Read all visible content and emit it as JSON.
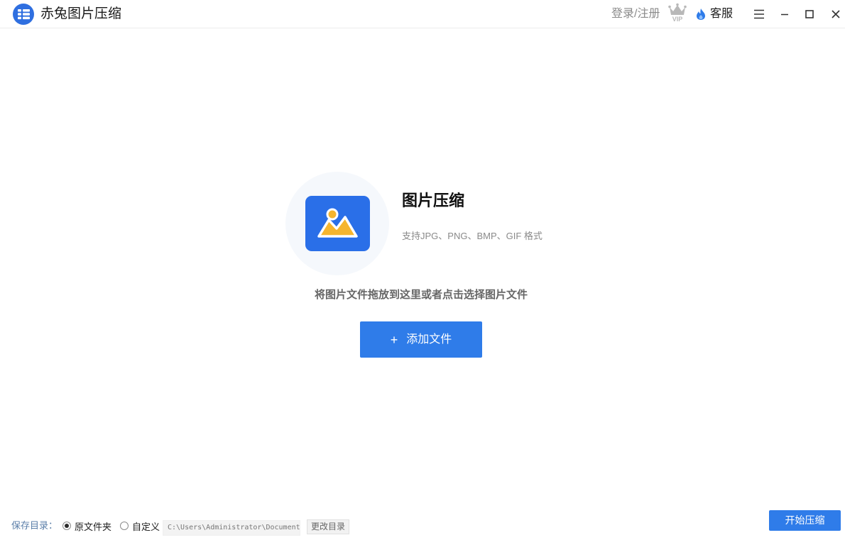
{
  "header": {
    "app_title": "赤兔图片压缩",
    "login_label": "登录/注册",
    "vip_label": "VIP",
    "service_label": "客服"
  },
  "main": {
    "title": "图片压缩",
    "subtitle": "支持JPG、PNG、BMP、GIF 格式",
    "drop_hint": "将图片文件拖放到这里或者点击选择图片文件",
    "add_button_plus": "+",
    "add_button_label": "添加文件"
  },
  "footer": {
    "save_dir_label": "保存目录：",
    "option_original": "原文件夹",
    "option_custom": "自定义",
    "custom_path": "C:\\Users\\Administrator\\Documents",
    "change_dir_label": "更改目录",
    "start_button_label": "开始压缩",
    "selected_option": "original"
  },
  "colors": {
    "accent": "#2f7ce9",
    "icon_bg": "#2a6fe8",
    "icon_yellow": "#f5b52e",
    "save_label": "#5a7ea8"
  },
  "icons": {
    "logo": "app-logo-icon",
    "vip": "crown-icon",
    "service": "flame-icon",
    "menu": "menu-icon",
    "minimize": "minimize-icon",
    "maximize": "maximize-icon",
    "close": "close-icon",
    "hero": "image-icon"
  }
}
